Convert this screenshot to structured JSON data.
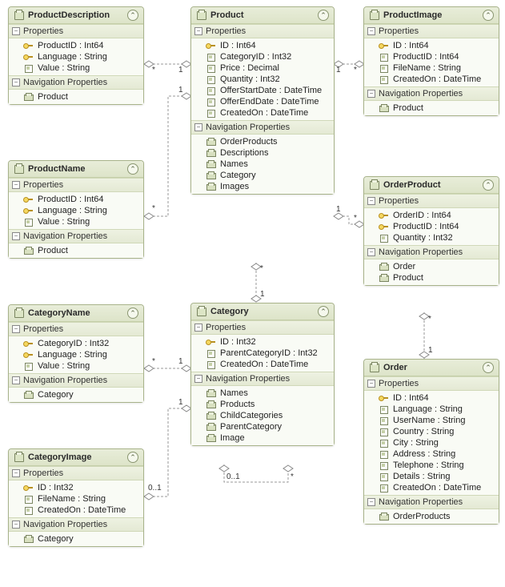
{
  "sections": {
    "properties": "Properties",
    "navprops": "Navigation Properties"
  },
  "entities": {
    "productDescription": {
      "title": "ProductDescription",
      "props": [
        "ProductID : Int64",
        "Language : String",
        "Value : String"
      ],
      "keyFlags": [
        true,
        true,
        false
      ],
      "navs": [
        "Product"
      ]
    },
    "productName": {
      "title": "ProductName",
      "props": [
        "ProductID : Int64",
        "Language : String",
        "Value : String"
      ],
      "keyFlags": [
        true,
        true,
        false
      ],
      "navs": [
        "Product"
      ]
    },
    "categoryName": {
      "title": "CategoryName",
      "props": [
        "CategoryID : Int32",
        "Language : String",
        "Value : String"
      ],
      "keyFlags": [
        true,
        true,
        false
      ],
      "navs": [
        "Category"
      ]
    },
    "categoryImage": {
      "title": "CategoryImage",
      "props": [
        "ID : Int32",
        "FileName : String",
        "CreatedOn : DateTime"
      ],
      "keyFlags": [
        true,
        false,
        false
      ],
      "navs": [
        "Category"
      ]
    },
    "product": {
      "title": "Product",
      "props": [
        "ID : Int64",
        "CategoryID : Int32",
        "Price : Decimal",
        "Quantity : Int32",
        "OfferStartDate : DateTime",
        "OfferEndDate : DateTime",
        "CreatedOn : DateTime"
      ],
      "keyFlags": [
        true,
        false,
        false,
        false,
        false,
        false,
        false
      ],
      "navs": [
        "OrderProducts",
        "Descriptions",
        "Names",
        "Category",
        "Images"
      ]
    },
    "category": {
      "title": "Category",
      "props": [
        "ID : Int32",
        "ParentCategoryID : Int32",
        "CreatedOn : DateTime"
      ],
      "keyFlags": [
        true,
        false,
        false
      ],
      "navs": [
        "Names",
        "Products",
        "ChildCategories",
        "ParentCategory",
        "Image"
      ]
    },
    "productImage": {
      "title": "ProductImage",
      "props": [
        "ID : Int64",
        "ProductID : Int64",
        "FileName : String",
        "CreatedOn : DateTime"
      ],
      "keyFlags": [
        true,
        false,
        false,
        false
      ],
      "navs": [
        "Product"
      ]
    },
    "orderProduct": {
      "title": "OrderProduct",
      "props": [
        "OrderID : Int64",
        "ProductID : Int64",
        "Quantity : Int32"
      ],
      "keyFlags": [
        true,
        true,
        false
      ],
      "navs": [
        "Order",
        "Product"
      ]
    },
    "order": {
      "title": "Order",
      "props": [
        "ID : Int64",
        "Language : String",
        "UserName : String",
        "Country : String",
        "City : String",
        "Address : String",
        "Telephone : String",
        "Details : String",
        "CreatedOn : DateTime"
      ],
      "keyFlags": [
        true,
        false,
        false,
        false,
        false,
        false,
        false,
        false,
        false
      ],
      "navs": [
        "OrderProducts"
      ]
    }
  },
  "multiplicities": {
    "pd_star": "*",
    "pd_one": "1",
    "pn_star": "*",
    "pn_one": "1",
    "cn_star": "*",
    "cn_one": "1",
    "ci_zeroOne": "0..1",
    "ci_one": "1",
    "pi_one": "1",
    "pi_star": "*",
    "op_one": "1",
    "op_star": "*",
    "pc_star": "*",
    "pc_one": "1",
    "op_ord_star": "*",
    "op_ord_one": "1",
    "cat_self_zeroOne": "0..1",
    "cat_self_star": "*"
  }
}
